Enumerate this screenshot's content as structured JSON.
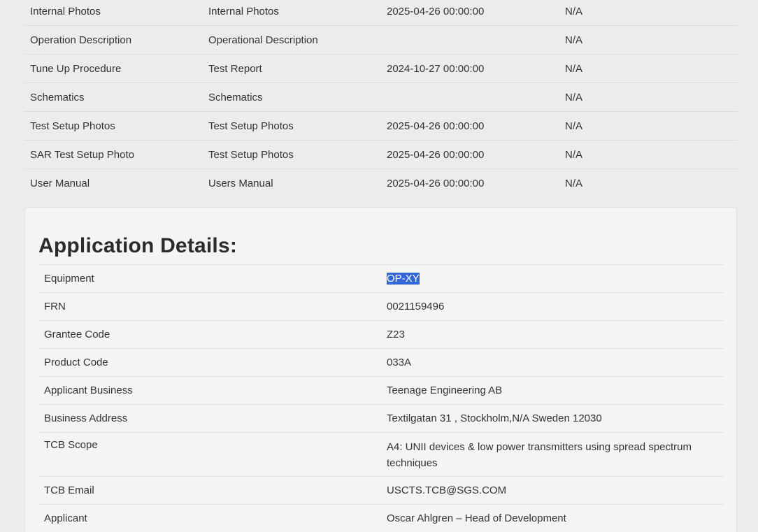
{
  "exhibits": [
    {
      "exhibit": "Internal Photos",
      "type": "Internal Photos",
      "date": "2025-04-26 00:00:00",
      "confidential": "N/A"
    },
    {
      "exhibit": "Operation Description",
      "type": "Operational Description",
      "date": "",
      "confidential": "N/A"
    },
    {
      "exhibit": "Tune Up Procedure",
      "type": "Test Report",
      "date": "2024-10-27 00:00:00",
      "confidential": "N/A"
    },
    {
      "exhibit": "Schematics",
      "type": "Schematics",
      "date": "",
      "confidential": "N/A"
    },
    {
      "exhibit": "Test Setup Photos",
      "type": "Test Setup Photos",
      "date": "2025-04-26 00:00:00",
      "confidential": "N/A"
    },
    {
      "exhibit": "SAR Test Setup Photo",
      "type": "Test Setup Photos",
      "date": "2025-04-26 00:00:00",
      "confidential": "N/A"
    },
    {
      "exhibit": "User Manual",
      "type": "Users Manual",
      "date": "2025-04-26 00:00:00",
      "confidential": "N/A"
    }
  ],
  "application": {
    "title": "Application Details:",
    "rows": [
      {
        "label": "Equipment",
        "value": "OP-XY"
      },
      {
        "label": "FRN",
        "value": "0021159496"
      },
      {
        "label": "Grantee Code",
        "value": "Z23"
      },
      {
        "label": "Product Code",
        "value": "033A"
      },
      {
        "label": "Applicant Business",
        "value": "Teenage Engineering AB"
      },
      {
        "label": "Business Address",
        "value": "Textilgatan 31 , Stockholm,N/A Sweden 12030"
      },
      {
        "label": "TCB Scope",
        "value": "A4: UNII devices & low power transmitters using spread spectrum techniques"
      },
      {
        "label": "TCB Email",
        "value": "USCTS.TCB@SGS.COM"
      },
      {
        "label": "Applicant",
        "value": "Oscar Ahlgren – Head of Development"
      }
    ]
  },
  "colors": {
    "selection": "#3367d6",
    "page_background": "#ececec",
    "panel_background": "#f4f4f4"
  }
}
